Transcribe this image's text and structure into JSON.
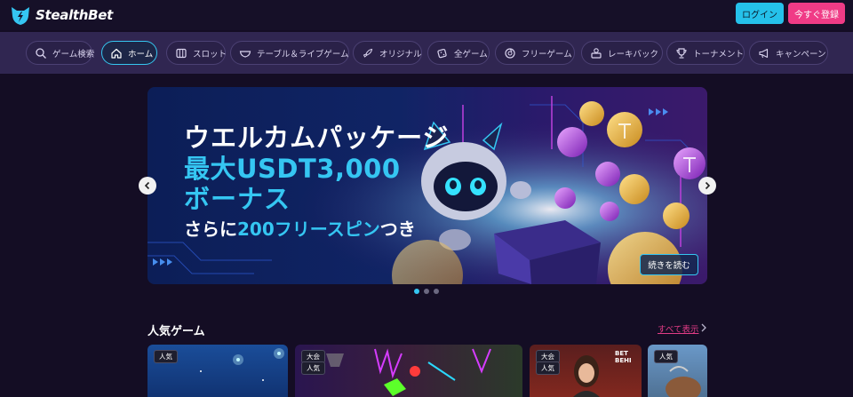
{
  "header": {
    "brand": "StealthBet",
    "login_label": "ログイン",
    "register_label": "今すぐ登録"
  },
  "nav": {
    "items": [
      {
        "label": "ゲーム検索",
        "icon": "search-icon"
      },
      {
        "label": "ホーム",
        "icon": "home-icon",
        "active": true
      },
      {
        "label": "スロット",
        "icon": "slot-icon"
      },
      {
        "label": "テーブル＆ライブゲーム",
        "icon": "table-icon"
      },
      {
        "label": "オリジナル",
        "icon": "rocket-icon"
      },
      {
        "label": "全ゲーム",
        "icon": "dice-icon"
      },
      {
        "label": "フリーゲーム",
        "icon": "spin-icon"
      },
      {
        "label": "レーキバック",
        "icon": "rakeback-icon"
      },
      {
        "label": "トーナメント",
        "icon": "trophy-icon"
      },
      {
        "label": "キャンペーン",
        "icon": "megaphone-icon"
      }
    ]
  },
  "banner": {
    "title_line1": "ウエルカムパッケージ",
    "title_line2": "最大USDT3,000",
    "title_line3": "ボーナス",
    "subtitle_prefix": "さらに",
    "subtitle_highlight": "200フリースピン",
    "subtitle_suffix": "つき",
    "read_more_label": "続きを読む",
    "slide_count": 3,
    "active_slide": 1
  },
  "popular": {
    "title": "人気ゲーム",
    "see_all_label": "すべて表示",
    "cards": [
      {
        "badges": [
          "人気"
        ]
      },
      {
        "badges": [
          "大会",
          "人気"
        ]
      },
      {
        "badges": [
          "大会",
          "人気"
        ],
        "sign": "BET BEHI"
      },
      {
        "badges": [
          "人気"
        ]
      }
    ]
  },
  "colors": {
    "accent_cyan": "#35c6f2",
    "accent_pink": "#f03b86",
    "background": "#140d24",
    "nav_bg": "#302651"
  }
}
